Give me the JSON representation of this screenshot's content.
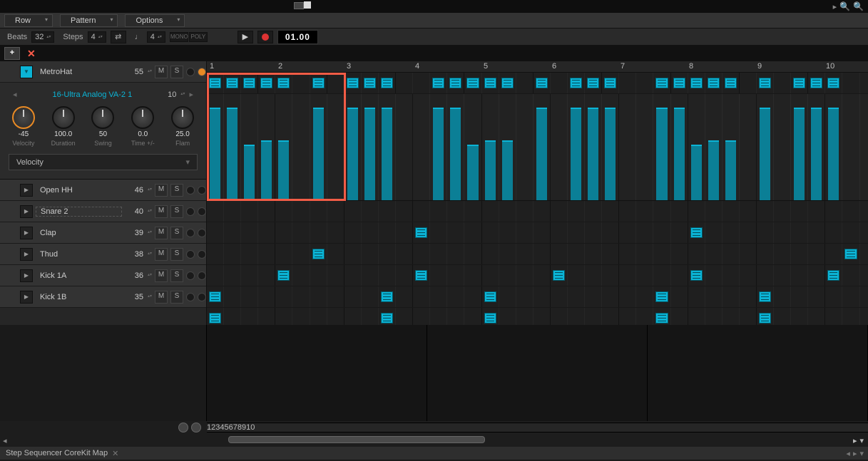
{
  "menu": {
    "row": "Row",
    "pattern": "Pattern",
    "options": "Options"
  },
  "toolbar": {
    "beats_label": "Beats",
    "beats_value": "32",
    "steps_label": "Steps",
    "steps_value": "4",
    "note_value": "4",
    "mono": "MONO",
    "poly": "POLY",
    "timecode": "01.00"
  },
  "preset": {
    "name": "16-Ultra Analog VA-2 1",
    "slot": "10"
  },
  "knobs": [
    {
      "val": "-45",
      "label": "Velocity"
    },
    {
      "val": "100.0",
      "label": "Duration"
    },
    {
      "val": "50",
      "label": "Swing"
    },
    {
      "val": "0.0",
      "label": "Time +/-"
    },
    {
      "val": "25.0",
      "label": "Flam"
    }
  ],
  "selector": {
    "param": "Velocity"
  },
  "tracks": [
    {
      "name": "MetroHat",
      "ch": "55",
      "expanded": true
    },
    {
      "name": "Open HH",
      "ch": "46",
      "expanded": false
    },
    {
      "name": "Snare 2",
      "ch": "40",
      "expanded": false
    },
    {
      "name": "Clap",
      "ch": "39",
      "expanded": false
    },
    {
      "name": "Thud",
      "ch": "38",
      "expanded": false
    },
    {
      "name": "Kick 1A",
      "ch": "36",
      "expanded": false
    },
    {
      "name": "Kick 1B",
      "ch": "35",
      "expanded": false
    }
  ],
  "ruler_marks": [
    "1",
    "2",
    "3",
    "4",
    "5",
    "6",
    "7",
    "8",
    "9",
    "10"
  ],
  "velocity_pattern": [
    100,
    100,
    60,
    65,
    65,
    0,
    100,
    0,
    100,
    100,
    100,
    0,
    0,
    100,
    100,
    60,
    65,
    65,
    0,
    100,
    0,
    100,
    100,
    100,
    0,
    0,
    100,
    100,
    60,
    65,
    65,
    0,
    100,
    0,
    100,
    100,
    100,
    0
  ],
  "pattern_0": [
    1,
    1,
    1,
    1,
    1,
    0,
    1,
    0,
    1,
    1,
    1,
    0,
    0,
    1,
    1,
    1,
    1,
    1,
    0,
    1,
    0,
    1,
    1,
    1,
    0,
    0,
    1,
    1,
    1,
    1,
    1,
    0,
    1,
    0,
    1,
    1,
    1,
    0
  ],
  "pattern_openhh": [
    0,
    0,
    0,
    0,
    0,
    0,
    0,
    0,
    0,
    0,
    0,
    0,
    0,
    0,
    0,
    0,
    0,
    0,
    0,
    0,
    0,
    0,
    0,
    0,
    0,
    0,
    0,
    0,
    0,
    0,
    0,
    0,
    0,
    0,
    0,
    0,
    0,
    0
  ],
  "pattern_snare2": [
    0,
    0,
    0,
    0,
    0,
    0,
    0,
    0,
    0,
    0,
    0,
    0,
    1,
    0,
    0,
    0,
    0,
    0,
    0,
    0,
    0,
    0,
    0,
    0,
    0,
    0,
    0,
    0,
    1,
    0,
    0,
    0,
    0,
    0,
    0,
    0,
    0,
    0
  ],
  "pattern_clap": [
    0,
    0,
    0,
    0,
    0,
    0,
    1,
    0,
    0,
    0,
    0,
    0,
    0,
    0,
    0,
    0,
    0,
    0,
    0,
    0,
    0,
    0,
    0,
    0,
    0,
    0,
    0,
    0,
    0,
    0,
    0,
    0,
    0,
    0,
    0,
    0,
    0,
    1
  ],
  "pattern_thud": [
    0,
    0,
    0,
    0,
    1,
    0,
    0,
    0,
    0,
    0,
    0,
    0,
    1,
    0,
    0,
    0,
    0,
    0,
    0,
    0,
    1,
    0,
    0,
    0,
    0,
    0,
    0,
    0,
    1,
    0,
    0,
    0,
    0,
    0,
    0,
    0,
    1,
    0
  ],
  "pattern_kick1a": [
    1,
    0,
    0,
    0,
    0,
    0,
    0,
    0,
    0,
    0,
    1,
    0,
    0,
    0,
    0,
    0,
    1,
    0,
    0,
    0,
    0,
    0,
    0,
    0,
    0,
    0,
    1,
    0,
    0,
    0,
    0,
    0,
    1,
    0,
    0,
    0,
    0,
    0
  ],
  "pattern_kick1b": [
    1,
    0,
    0,
    0,
    0,
    0,
    0,
    0,
    0,
    0,
    1,
    0,
    0,
    0,
    0,
    0,
    1,
    0,
    0,
    0,
    0,
    0,
    0,
    0,
    0,
    0,
    1,
    0,
    0,
    0,
    0,
    0,
    1,
    0,
    0,
    0,
    0,
    0
  ],
  "footer": {
    "tab_label": "Step Sequencer CoreKit Map"
  }
}
